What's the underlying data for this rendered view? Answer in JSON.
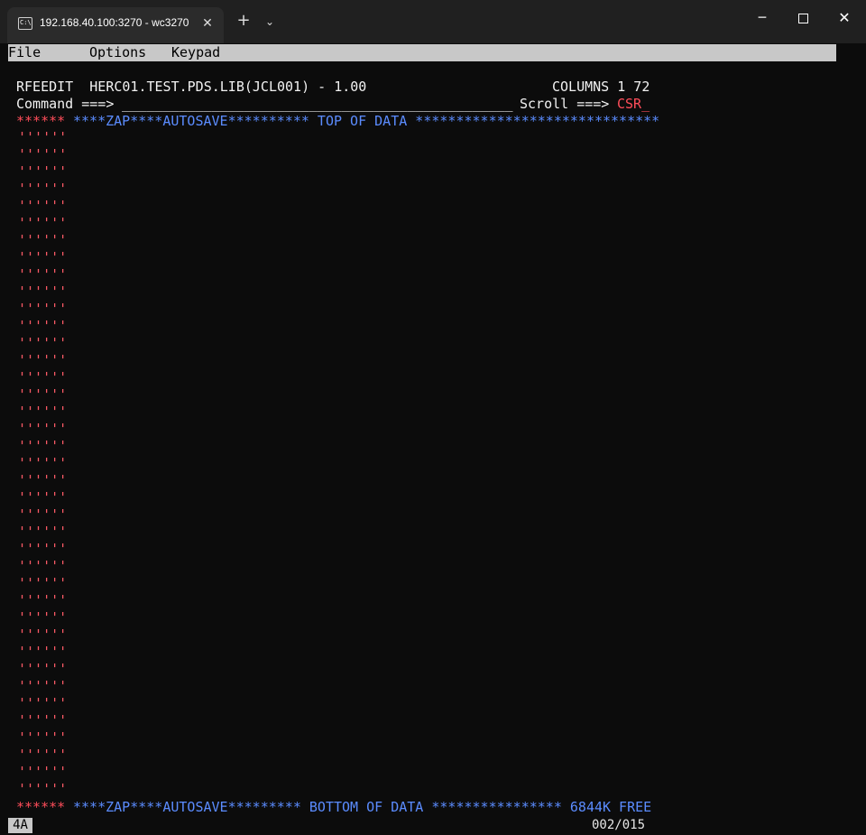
{
  "window": {
    "tab_title": "192.168.40.100:3270 - wc3270",
    "tab_icon": "terminal-icon",
    "close_tab_glyph": "✕",
    "new_tab_glyph": "+",
    "tab_menu_glyph": "⌄",
    "minimize_glyph": "─",
    "close_glyph": "✕"
  },
  "menubar": {
    "file": "File",
    "options": "Options",
    "keypad": "Keypad"
  },
  "editor": {
    "title": "RFEEDIT  HERC01.TEST.PDS.LIB(JCL001) - 1.00",
    "columns": "COLUMNS 1 72",
    "command_label": "Command ===>",
    "command_field": "________________________________________________",
    "scroll_label": "Scroll ===>",
    "scroll_value": "CSR_",
    "top_marker": "******",
    "top_banner": "****ZAP****AUTOSAVE********** TOP OF DATA ******************************",
    "bottom_marker": "******",
    "bottom_banner": "****ZAP****AUTOSAVE********* BOTTOM OF DATA **************** 6844K FREE",
    "empty_line_marker": "''''''",
    "empty_line_count": 39
  },
  "status": {
    "left": "4A",
    "right": "002/015"
  },
  "colors": {
    "background": "#0c0c0c",
    "red": "#ff4d5a",
    "blue": "#5b8cff",
    "white": "#f2f2f2",
    "menubar": "#c8c8c8"
  }
}
